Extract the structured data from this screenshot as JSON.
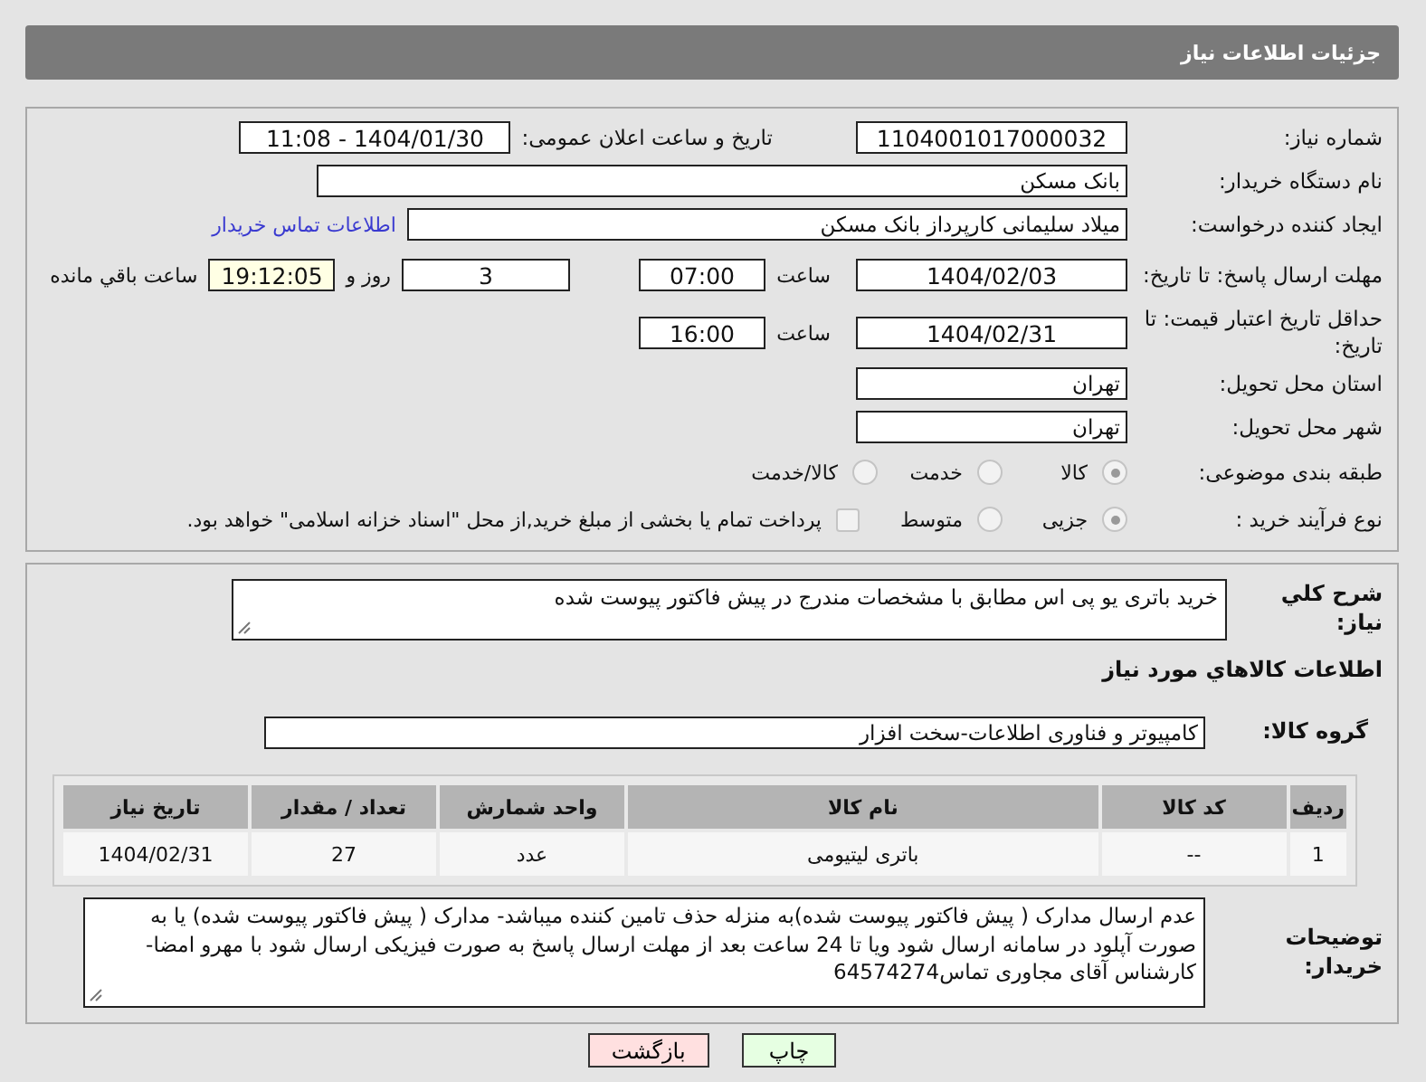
{
  "page_title": "جزئیات اطلاعات نیاز",
  "need_number": {
    "label": "شماره نیاز:",
    "value": "1104001017000032"
  },
  "announce": {
    "label": "تاریخ و ساعت اعلان عمومی:",
    "value": "1404/01/30 - 11:08"
  },
  "buyer_org": {
    "label": "نام دستگاه خریدار:",
    "value": "بانک مسکن"
  },
  "requester": {
    "label": "ایجاد کننده درخواست:",
    "value": "میلاد سلیمانی کارپرداز بانک مسکن",
    "link": "اطلاعات تماس خریدار"
  },
  "reply_deadline": {
    "label": "مهلت ارسال پاسخ: تا تاریخ:",
    "date": "1404/02/03",
    "time_label": "ساعت",
    "time": "07:00",
    "days": "3",
    "days_label": "روز و",
    "remaining": "19:12:05",
    "remaining_label": "ساعت باقي مانده"
  },
  "price_validity": {
    "label": "حداقل تاریخ اعتبار قیمت: تا تاریخ:",
    "date": "1404/02/31",
    "time_label": "ساعت",
    "time": "16:00"
  },
  "province": {
    "label": "استان محل تحویل:",
    "value": "تهران"
  },
  "city": {
    "label": "شهر محل تحویل:",
    "value": "تهران"
  },
  "category": {
    "label": "طبقه بندی موضوعی:",
    "options": [
      {
        "label": "کالا",
        "selected": true
      },
      {
        "label": "خدمت",
        "selected": false
      },
      {
        "label": "کالا/خدمت",
        "selected": false
      }
    ]
  },
  "process": {
    "label": "نوع فرآیند خرید :",
    "options": [
      {
        "label": "جزیی",
        "selected": true
      },
      {
        "label": "متوسط",
        "selected": false
      }
    ],
    "payment": {
      "checked": false,
      "label": "پرداخت تمام یا بخشی از مبلغ خرید,از محل \"اسناد خزانه اسلامی\" خواهد بود."
    }
  },
  "description": {
    "label": "شرح کلي نیاز:",
    "value": "خرید باتری یو پی اس مطابق با مشخصات مندرج در پیش فاکتور پیوست شده"
  },
  "goods_heading": "اطلاعات کالاهاي مورد نیاز",
  "goods_group": {
    "label": "گروه کالا:",
    "value": "کامپیوتر و فناوری اطلاعات-سخت افزار"
  },
  "table": {
    "columns": [
      "ردیف",
      "کد کالا",
      "نام کالا",
      "واحد شمارش",
      "تعداد / مقدار",
      "تاریخ نیاز"
    ],
    "rows": [
      [
        "1",
        "--",
        "باتری لیتیومی",
        "عدد",
        "27",
        "1404/02/31"
      ]
    ]
  },
  "buyer_notes": {
    "label": "توضیحات خریدار:",
    "value": "عدم ارسال مدارک ( پیش فاکتور پیوست شده)به منزله حذف تامین کننده میباشد- مدارک ( پیش فاکتور پیوست شده) یا به صورت آپلود در سامانه ارسال شود ویا تا 24 ساعت بعد از مهلت ارسال پاسخ به صورت فیزیکی ارسال شود با مهرو امضا- کارشناس آقای مجاوری تماس64574274"
  },
  "buttons": [
    {
      "label": "چاپ",
      "kind": "print"
    },
    {
      "label": "بازگشت",
      "kind": "back"
    }
  ]
}
